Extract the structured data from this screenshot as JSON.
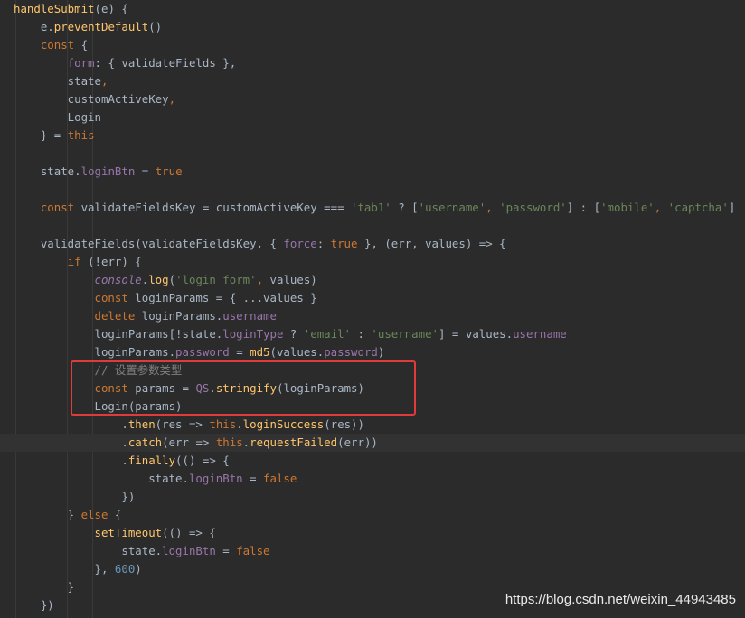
{
  "code_lines": [
    [
      [
        "t-fn",
        "handleSubmit"
      ],
      [
        "t-plain",
        "(e) {"
      ]
    ],
    [
      [
        "t-plain",
        "    e."
      ],
      [
        "t-fn",
        "preventDefault"
      ],
      [
        "t-plain",
        "()"
      ]
    ],
    [
      [
        "t-kw",
        "    const"
      ],
      [
        "t-plain",
        " {"
      ]
    ],
    [
      [
        "t-prop",
        "        form"
      ],
      [
        "t-plain",
        ": { validateFields },"
      ]
    ],
    [
      [
        "t-plain",
        "        state"
      ],
      [
        "t-kw",
        ","
      ]
    ],
    [
      [
        "t-plain",
        "        customActiveKey"
      ],
      [
        "t-kw",
        ","
      ]
    ],
    [
      [
        "t-plain",
        "        Login"
      ]
    ],
    [
      [
        "t-plain",
        "    } = "
      ],
      [
        "t-kw",
        "this"
      ]
    ],
    [],
    [
      [
        "t-plain",
        "    state."
      ],
      [
        "t-prop",
        "loginBtn"
      ],
      [
        "t-plain",
        " = "
      ],
      [
        "t-kw",
        "true"
      ]
    ],
    [],
    [
      [
        "t-kw",
        "    const"
      ],
      [
        "t-plain",
        " validateFieldsKey = customActiveKey === "
      ],
      [
        "t-str",
        "'tab1'"
      ],
      [
        "t-plain",
        " ? ["
      ],
      [
        "t-str",
        "'username'"
      ],
      [
        "t-kw",
        ", "
      ],
      [
        "t-str",
        "'password'"
      ],
      [
        "t-plain",
        "] : ["
      ],
      [
        "t-str",
        "'mobile'"
      ],
      [
        "t-kw",
        ", "
      ],
      [
        "t-str",
        "'captcha'"
      ],
      [
        "t-plain",
        "]"
      ]
    ],
    [],
    [
      [
        "t-plain",
        "    validateFields(validateFieldsKey, { "
      ],
      [
        "t-prop",
        "force"
      ],
      [
        "t-plain",
        ": "
      ],
      [
        "t-kw",
        "true"
      ],
      [
        "t-plain",
        " }, (err, values) => {"
      ]
    ],
    [
      [
        "t-kw",
        "        if"
      ],
      [
        "t-plain",
        " (!err) {"
      ]
    ],
    [
      [
        "t-ital",
        "            console"
      ],
      [
        "t-plain",
        "."
      ],
      [
        "t-fn",
        "log"
      ],
      [
        "t-plain",
        "("
      ],
      [
        "t-str",
        "'login form'"
      ],
      [
        "t-kw",
        ", "
      ],
      [
        "t-plain",
        "values)"
      ]
    ],
    [
      [
        "t-kw",
        "            const"
      ],
      [
        "t-plain",
        " loginParams = { ...values }"
      ]
    ],
    [
      [
        "t-kw",
        "            delete"
      ],
      [
        "t-plain",
        " loginParams."
      ],
      [
        "t-prop",
        "username"
      ]
    ],
    [
      [
        "t-plain",
        "            loginParams[!state."
      ],
      [
        "t-prop",
        "loginType"
      ],
      [
        "t-plain",
        " ? "
      ],
      [
        "t-str",
        "'email'"
      ],
      [
        "t-plain",
        " : "
      ],
      [
        "t-str",
        "'username'"
      ],
      [
        "t-plain",
        "] = values."
      ],
      [
        "t-prop",
        "username"
      ]
    ],
    [
      [
        "t-plain",
        "            loginParams."
      ],
      [
        "t-prop",
        "password"
      ],
      [
        "t-plain",
        " = "
      ],
      [
        "t-fn",
        "md5"
      ],
      [
        "t-plain",
        "(values."
      ],
      [
        "t-prop",
        "password"
      ],
      [
        "t-plain",
        ")"
      ]
    ],
    [
      [
        "t-com",
        "            // 设置参数类型"
      ]
    ],
    [
      [
        "t-kw",
        "            const"
      ],
      [
        "t-plain",
        " params = "
      ],
      [
        "t-prop",
        "QS"
      ],
      [
        "t-plain",
        "."
      ],
      [
        "t-fn",
        "stringify"
      ],
      [
        "t-plain",
        "(loginParams)"
      ]
    ],
    [
      [
        "t-plain",
        "            Login(params)"
      ]
    ],
    [
      [
        "t-plain",
        "                ."
      ],
      [
        "t-fn",
        "then"
      ],
      [
        "t-plain",
        "(res => "
      ],
      [
        "t-kw",
        "this"
      ],
      [
        "t-plain",
        "."
      ],
      [
        "t-fn",
        "loginSuccess"
      ],
      [
        "t-plain",
        "(res))"
      ]
    ],
    [
      [
        "t-plain",
        "                ."
      ],
      [
        "t-fn",
        "catch"
      ],
      [
        "t-plain",
        "(err => "
      ],
      [
        "t-kw",
        "this"
      ],
      [
        "t-plain",
        "."
      ],
      [
        "t-fn",
        "requestFailed"
      ],
      [
        "t-plain",
        "(err))"
      ]
    ],
    [
      [
        "t-plain",
        "                ."
      ],
      [
        "t-fn",
        "finally"
      ],
      [
        "t-plain",
        "(() => {"
      ]
    ],
    [
      [
        "t-plain",
        "                    state."
      ],
      [
        "t-prop",
        "loginBtn"
      ],
      [
        "t-plain",
        " = "
      ],
      [
        "t-kw",
        "false"
      ]
    ],
    [
      [
        "t-plain",
        "                })"
      ]
    ],
    [
      [
        "t-plain",
        "        } "
      ],
      [
        "t-kw",
        "else"
      ],
      [
        "t-plain",
        " {"
      ]
    ],
    [
      [
        "t-fn",
        "            setTimeout"
      ],
      [
        "t-plain",
        "(() => {"
      ]
    ],
    [
      [
        "t-plain",
        "                state."
      ],
      [
        "t-prop",
        "loginBtn"
      ],
      [
        "t-plain",
        " = "
      ],
      [
        "t-kw",
        "false"
      ]
    ],
    [
      [
        "t-plain",
        "            }, "
      ],
      [
        "t-num",
        "600"
      ],
      [
        "t-plain",
        ")"
      ]
    ],
    [
      [
        "t-plain",
        "        }"
      ]
    ],
    [
      [
        "t-plain",
        "    })"
      ]
    ]
  ],
  "current_line_index": 24,
  "highlight_box_color": "#e03b3b",
  "watermark": "https://blog.csdn.net/weixin_44943485"
}
